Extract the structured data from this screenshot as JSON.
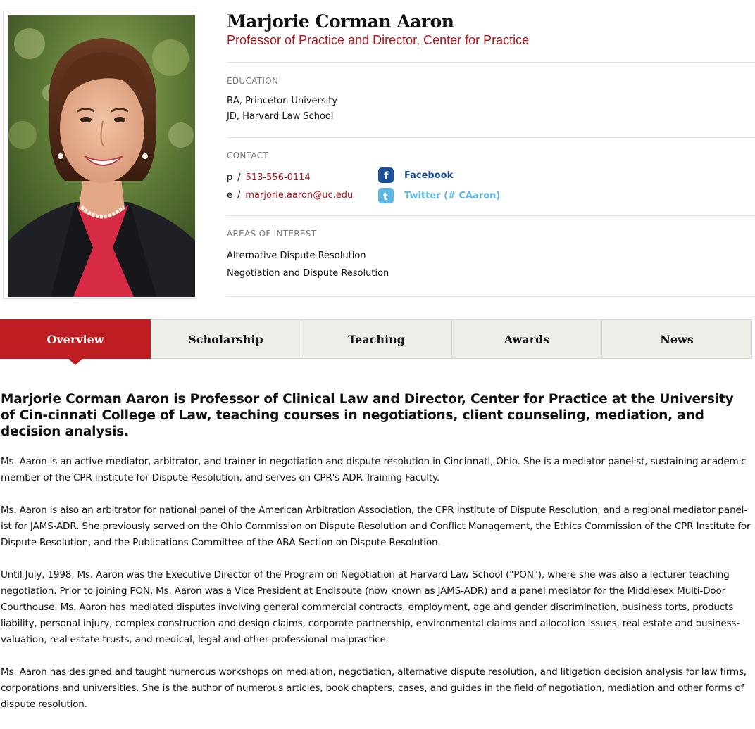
{
  "profile": {
    "name": "Marjorie Corman Aaron",
    "title": "Professor of Practice and Director, Center for Practice"
  },
  "education": {
    "label": "EDUCATION",
    "items": [
      "BA, Princeton University",
      "JD, Harvard Law School"
    ]
  },
  "contact": {
    "label": "CONTACT",
    "phone_prefix": "p",
    "phone": "513-556-0114",
    "email_prefix": "e",
    "email": "marjorie.aaron@uc.edu",
    "separator": "/",
    "facebook_label": "Facebook",
    "twitter_label": "Twitter (# CAaron)",
    "facebook_icon": "facebook-icon",
    "twitter_icon": "twitter-icon"
  },
  "interests": {
    "label": "AREAS OF INTEREST",
    "items": [
      "Alternative Dispute Resolution",
      "Negotiation and Dispute Resolution"
    ]
  },
  "tabs": [
    {
      "label": "Overview",
      "active": true
    },
    {
      "label": "Scholarship",
      "active": false
    },
    {
      "label": "Teaching",
      "active": false
    },
    {
      "label": "Awards",
      "active": false
    },
    {
      "label": "News",
      "active": false
    }
  ],
  "overview": {
    "lead": "Marjorie Corman Aaron is Professor of Clinical Law and Director, Center for Practice at the University of Cin-cinnati College of Law, teaching courses in negotiations, client counseling, mediation, and decision analysis.",
    "paragraphs": [
      "Ms. Aaron is an active mediator, arbitrator, and trainer in negotiation and dispute resolution in Cincinnati, Ohio. She is a mediator panelist, sustaining academic member of the CPR Institute for Dispute Resolution, and serves on CPR's ADR Training Faculty.",
      "Ms. Aaron is also an arbitrator for national panel of the American Arbitration Association, the CPR Institute of Dispute Resolution, and a regional mediator panel-ist for JAMS-ADR. She previously served on the Ohio Commission on Dispute Resolution and Conflict Management, the Ethics Commission of the CPR Institute for Dispute Resolution, and the Publications Committee of the ABA Section on Dispute Resolution.",
      "Until July, 1998, Ms. Aaron was the Executive Director of the Program on Negotiation at Harvard Law School (\"PON\"), where she was also a lecturer teaching negotiation. Prior to joining PON, Ms. Aaron was a Vice President at Endispute (now known as JAMS-ADR) and a panel mediator for the Middlesex Multi-Door Courthouse. Ms. Aaron has mediated disputes involving general commercial contracts, employment, age and gender discrimination, business torts, products liability, personal injury, complex construction and design claims, corporate partnership, environmental claims and allocation issues, real estate and business-valuation, real estate trusts, and medical, legal and other professional malpractice.",
      "Ms. Aaron has designed and taught numerous workshops on mediation, negotiation, alternative dispute resolution, and litigation decision analysis for law firms, corporations and universities. She is the author of numerous articles, book chapters, cases, and guides in the field of negotiation, mediation and other forms of dispute resolution."
    ]
  },
  "colors": {
    "accent_red": "#be1e22",
    "link_red": "#b5121b",
    "facebook_blue": "#1b4f9c",
    "twitter_blue": "#5eb7e2",
    "tab_bg": "#eeeee9"
  }
}
